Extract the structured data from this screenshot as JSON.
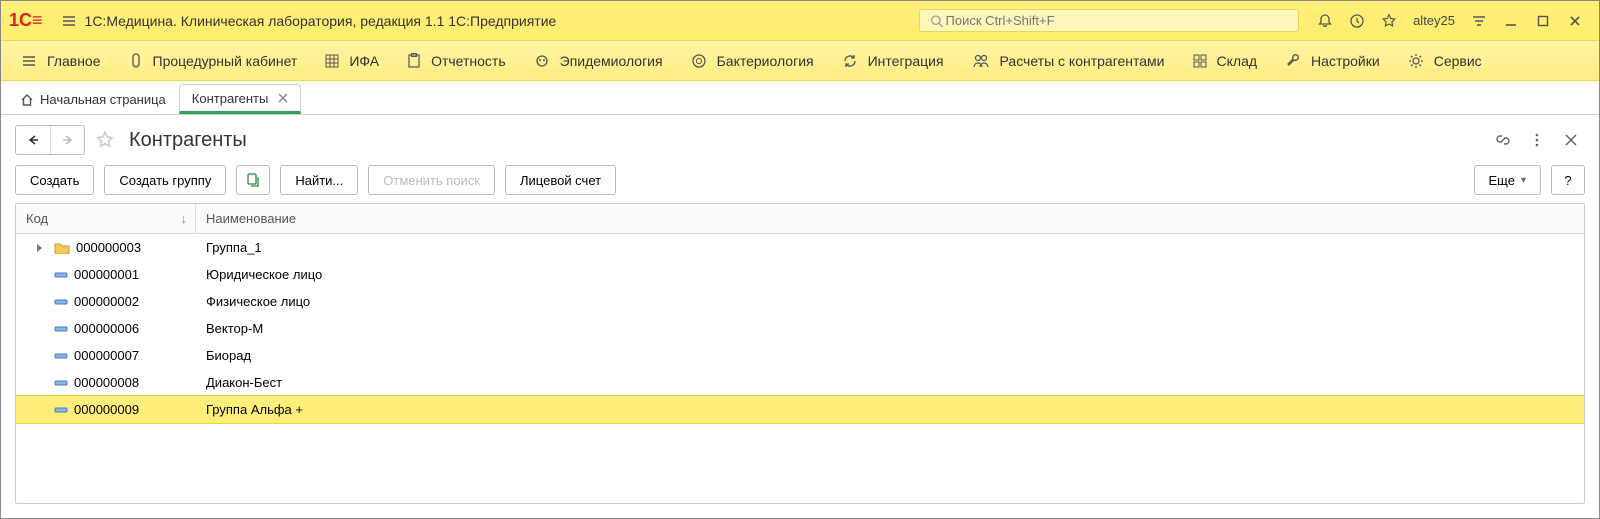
{
  "window": {
    "logo_text": "1C",
    "title": "1С:Медицина. Клиническая лаборатория, редакция 1.1 1С:Предприятие",
    "search_placeholder": "Поиск Ctrl+Shift+F",
    "user": "altey25"
  },
  "main_menu": {
    "items": [
      {
        "label": "Главное"
      },
      {
        "label": "Процедурный кабинет"
      },
      {
        "label": "ИФА"
      },
      {
        "label": "Отчетность"
      },
      {
        "label": "Эпидемиология"
      },
      {
        "label": "Бактериология"
      },
      {
        "label": "Интеграция"
      },
      {
        "label": "Расчеты с контрагентами"
      },
      {
        "label": "Склад"
      },
      {
        "label": "Настройки"
      },
      {
        "label": "Сервис"
      }
    ]
  },
  "tabs": {
    "home": "Начальная страница",
    "active": "Контрагенты"
  },
  "page": {
    "title": "Контрагенты"
  },
  "toolbar": {
    "create": "Создать",
    "create_group": "Создать группу",
    "find": "Найти...",
    "cancel_find": "Отменить поиск",
    "account": "Лицевой счет",
    "more": "Еще",
    "help": "?"
  },
  "grid": {
    "columns": {
      "code": "Код",
      "name": "Наименование"
    },
    "rows": [
      {
        "kind": "folder",
        "code": "000000003",
        "name": "Группа_1",
        "selected": false
      },
      {
        "kind": "item",
        "code": "000000001",
        "name": "Юридическое лицо",
        "selected": false
      },
      {
        "kind": "item",
        "code": "000000002",
        "name": "Физическое лицо",
        "selected": false
      },
      {
        "kind": "item",
        "code": "000000006",
        "name": "Вектор-М",
        "selected": false
      },
      {
        "kind": "item",
        "code": "000000007",
        "name": "Биорад",
        "selected": false
      },
      {
        "kind": "item",
        "code": "000000008",
        "name": "Диакон-Бест",
        "selected": false
      },
      {
        "kind": "item",
        "code": "000000009",
        "name": "Группа Альфа +",
        "selected": true
      }
    ]
  }
}
